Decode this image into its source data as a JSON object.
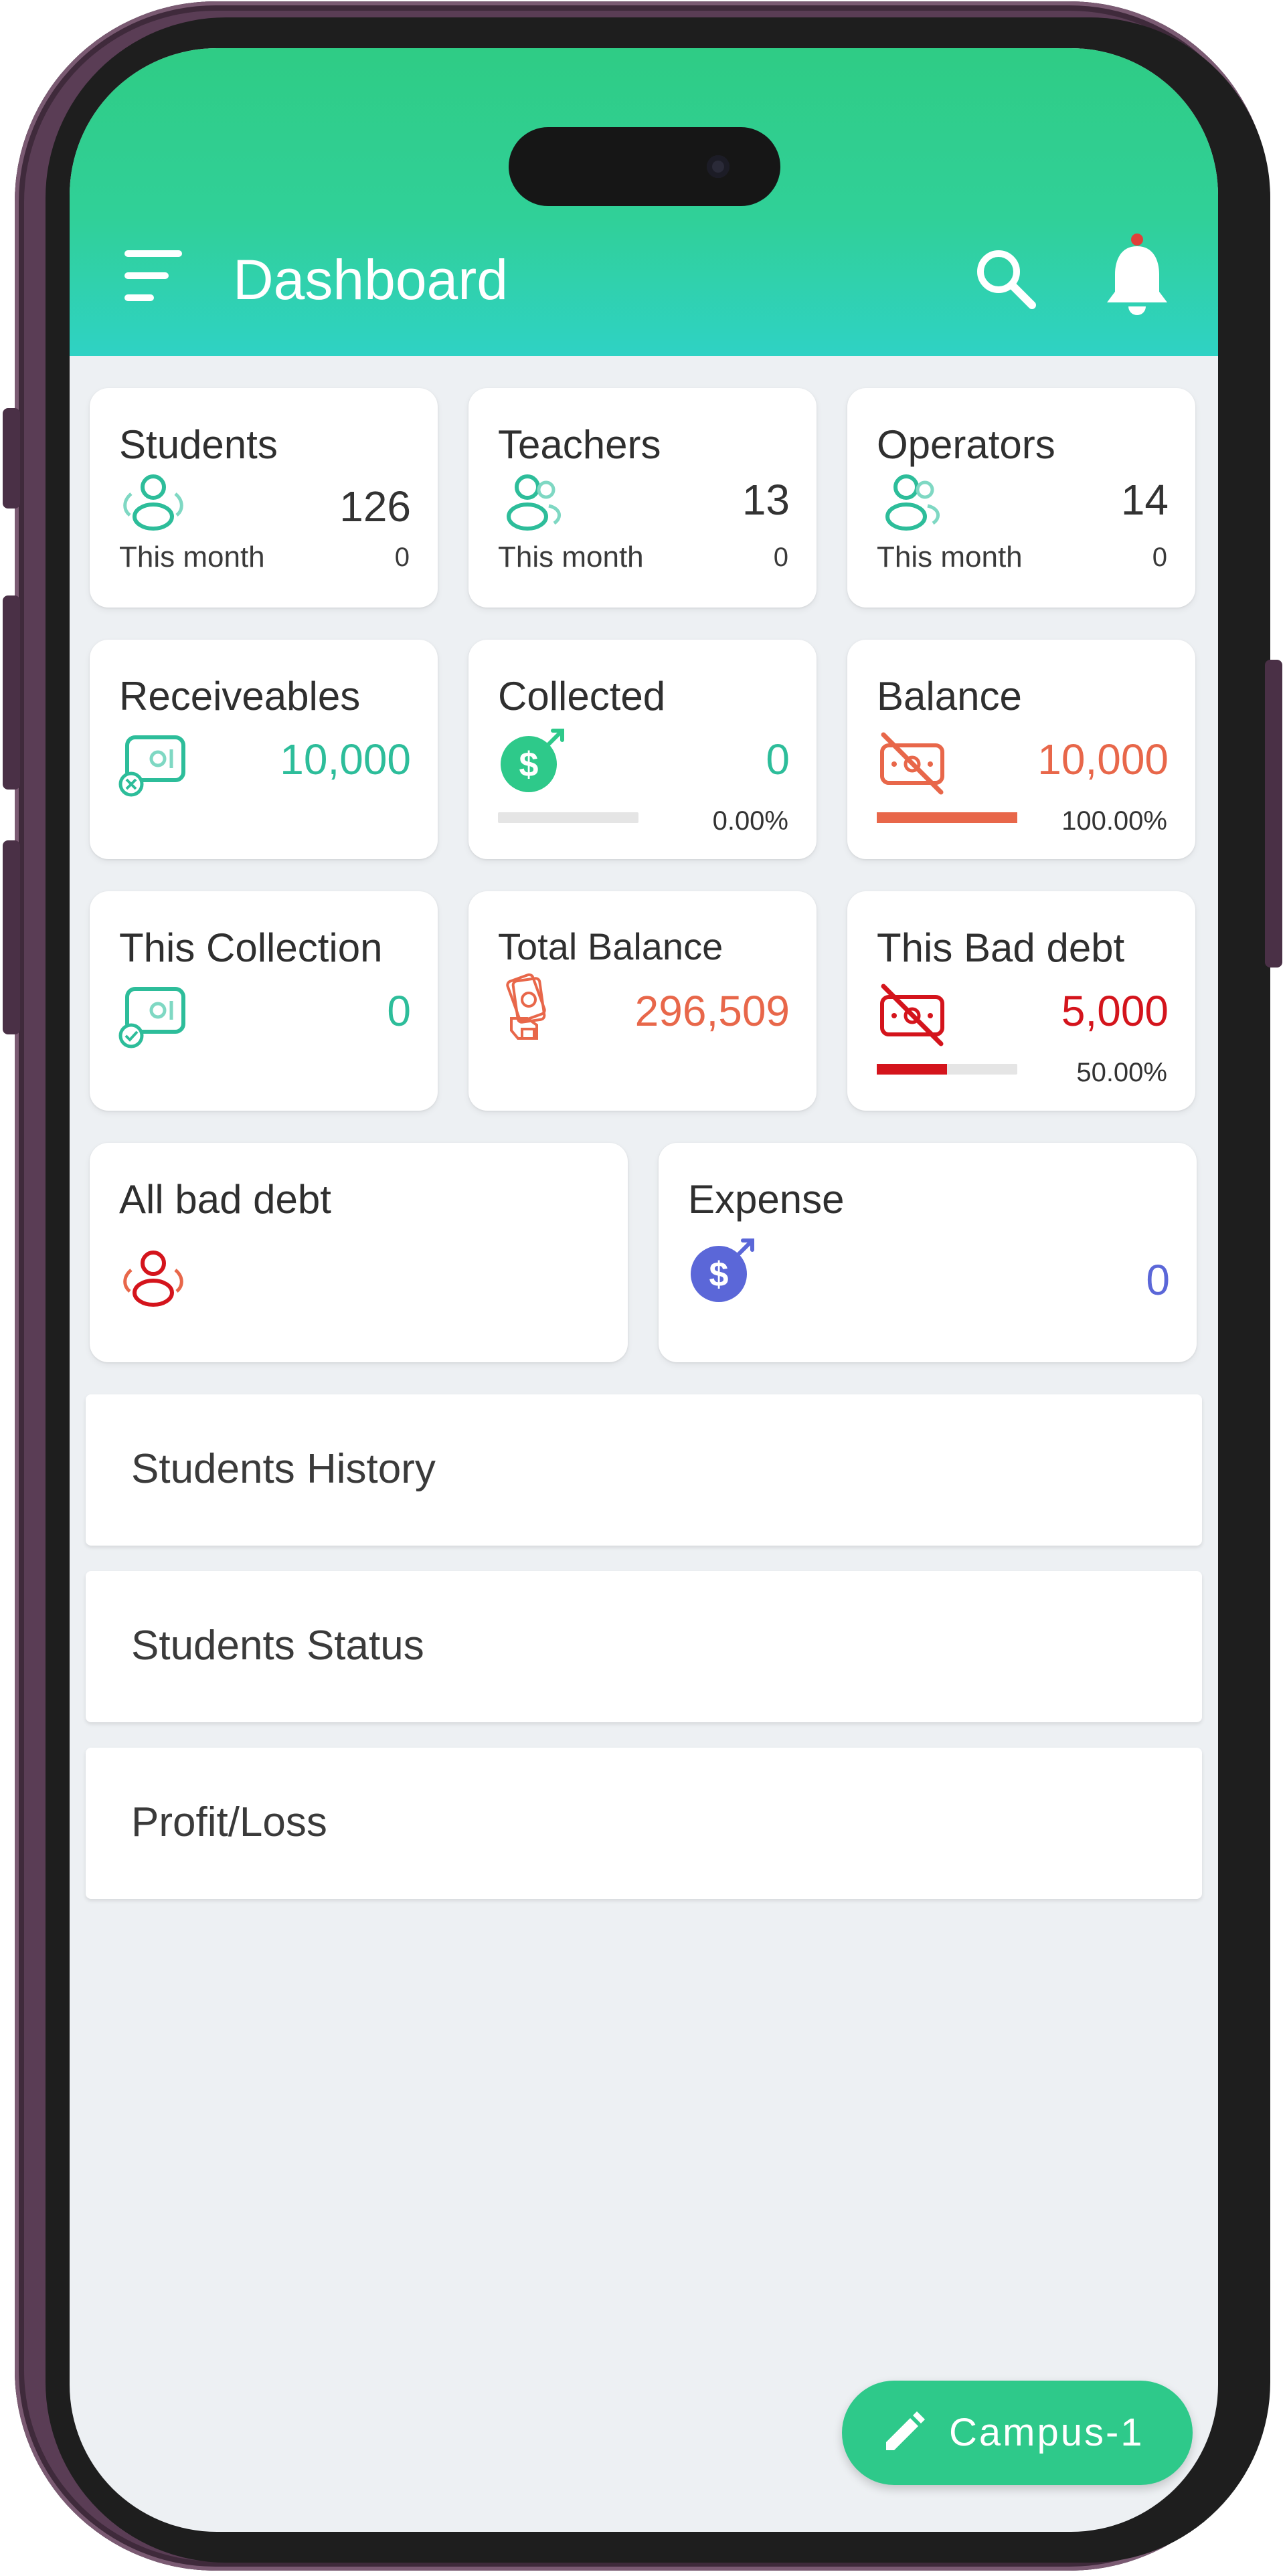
{
  "header": {
    "title": "Dashboard"
  },
  "colors": {
    "header_green": "#2fcc85",
    "accent_teal": "#2dbd9a",
    "balance_orange": "#e8674a",
    "bad_debt_red": "#d4141c",
    "expense_blue": "#5b67d8"
  },
  "cards": {
    "students": {
      "label": "Students",
      "value": "126",
      "sub_label": "This month",
      "sub_value": "0",
      "icon": "users-icon"
    },
    "teachers": {
      "label": "Teachers",
      "value": "13",
      "sub_label": "This month",
      "sub_value": "0",
      "icon": "users-icon"
    },
    "operators": {
      "label": "Operators",
      "value": "14",
      "sub_label": "This month",
      "sub_value": "0",
      "icon": "users-icon"
    },
    "receiveables": {
      "label": "Receiveables",
      "value": "10,000",
      "icon": "money-card-icon"
    },
    "collected": {
      "label": "Collected",
      "value": "0",
      "percent": "0.00%",
      "progress": 0,
      "icon": "dollar-arrow-icon"
    },
    "balance": {
      "label": "Balance",
      "value": "10,000",
      "percent": "100.00%",
      "progress": 1.0,
      "icon": "money-off-icon"
    },
    "this_collection": {
      "label": "This Collection",
      "value": "0",
      "icon": "money-check-icon"
    },
    "total_balance": {
      "label": "Total Balance",
      "value": "296,509",
      "icon": "money-hand-icon"
    },
    "this_bad_debt": {
      "label": "This Bad debt",
      "value": "5,000",
      "percent": "50.00%",
      "progress": 0.5,
      "icon": "money-off-icon"
    },
    "all_bad_debt": {
      "label": "All bad debt",
      "icon": "users-icon"
    },
    "expense": {
      "label": "Expense",
      "value": "0",
      "icon": "dollar-arrow-icon"
    }
  },
  "sections": [
    {
      "label": "Students History"
    },
    {
      "label": "Students Status"
    },
    {
      "label": "Profit/Loss"
    }
  ],
  "fab": {
    "label": "Campus-1",
    "icon": "pencil-icon"
  }
}
